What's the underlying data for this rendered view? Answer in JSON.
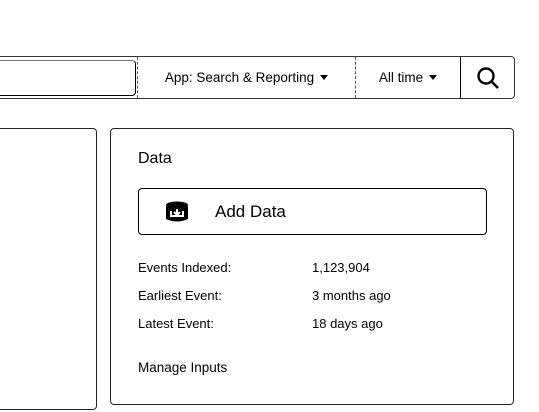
{
  "search": {
    "app_label": "App: Search & Reporting",
    "time_label": "All time",
    "input_value": ""
  },
  "data_panel": {
    "title": "Data",
    "add_data_label": "Add Data",
    "stats": [
      {
        "label": "Events Indexed:",
        "value": "1,123,904"
      },
      {
        "label": "Earliest Event:",
        "value": "3 months ago"
      },
      {
        "label": "Latest Event:",
        "value": "18 days ago"
      }
    ],
    "manage_inputs_label": "Manage Inputs"
  }
}
